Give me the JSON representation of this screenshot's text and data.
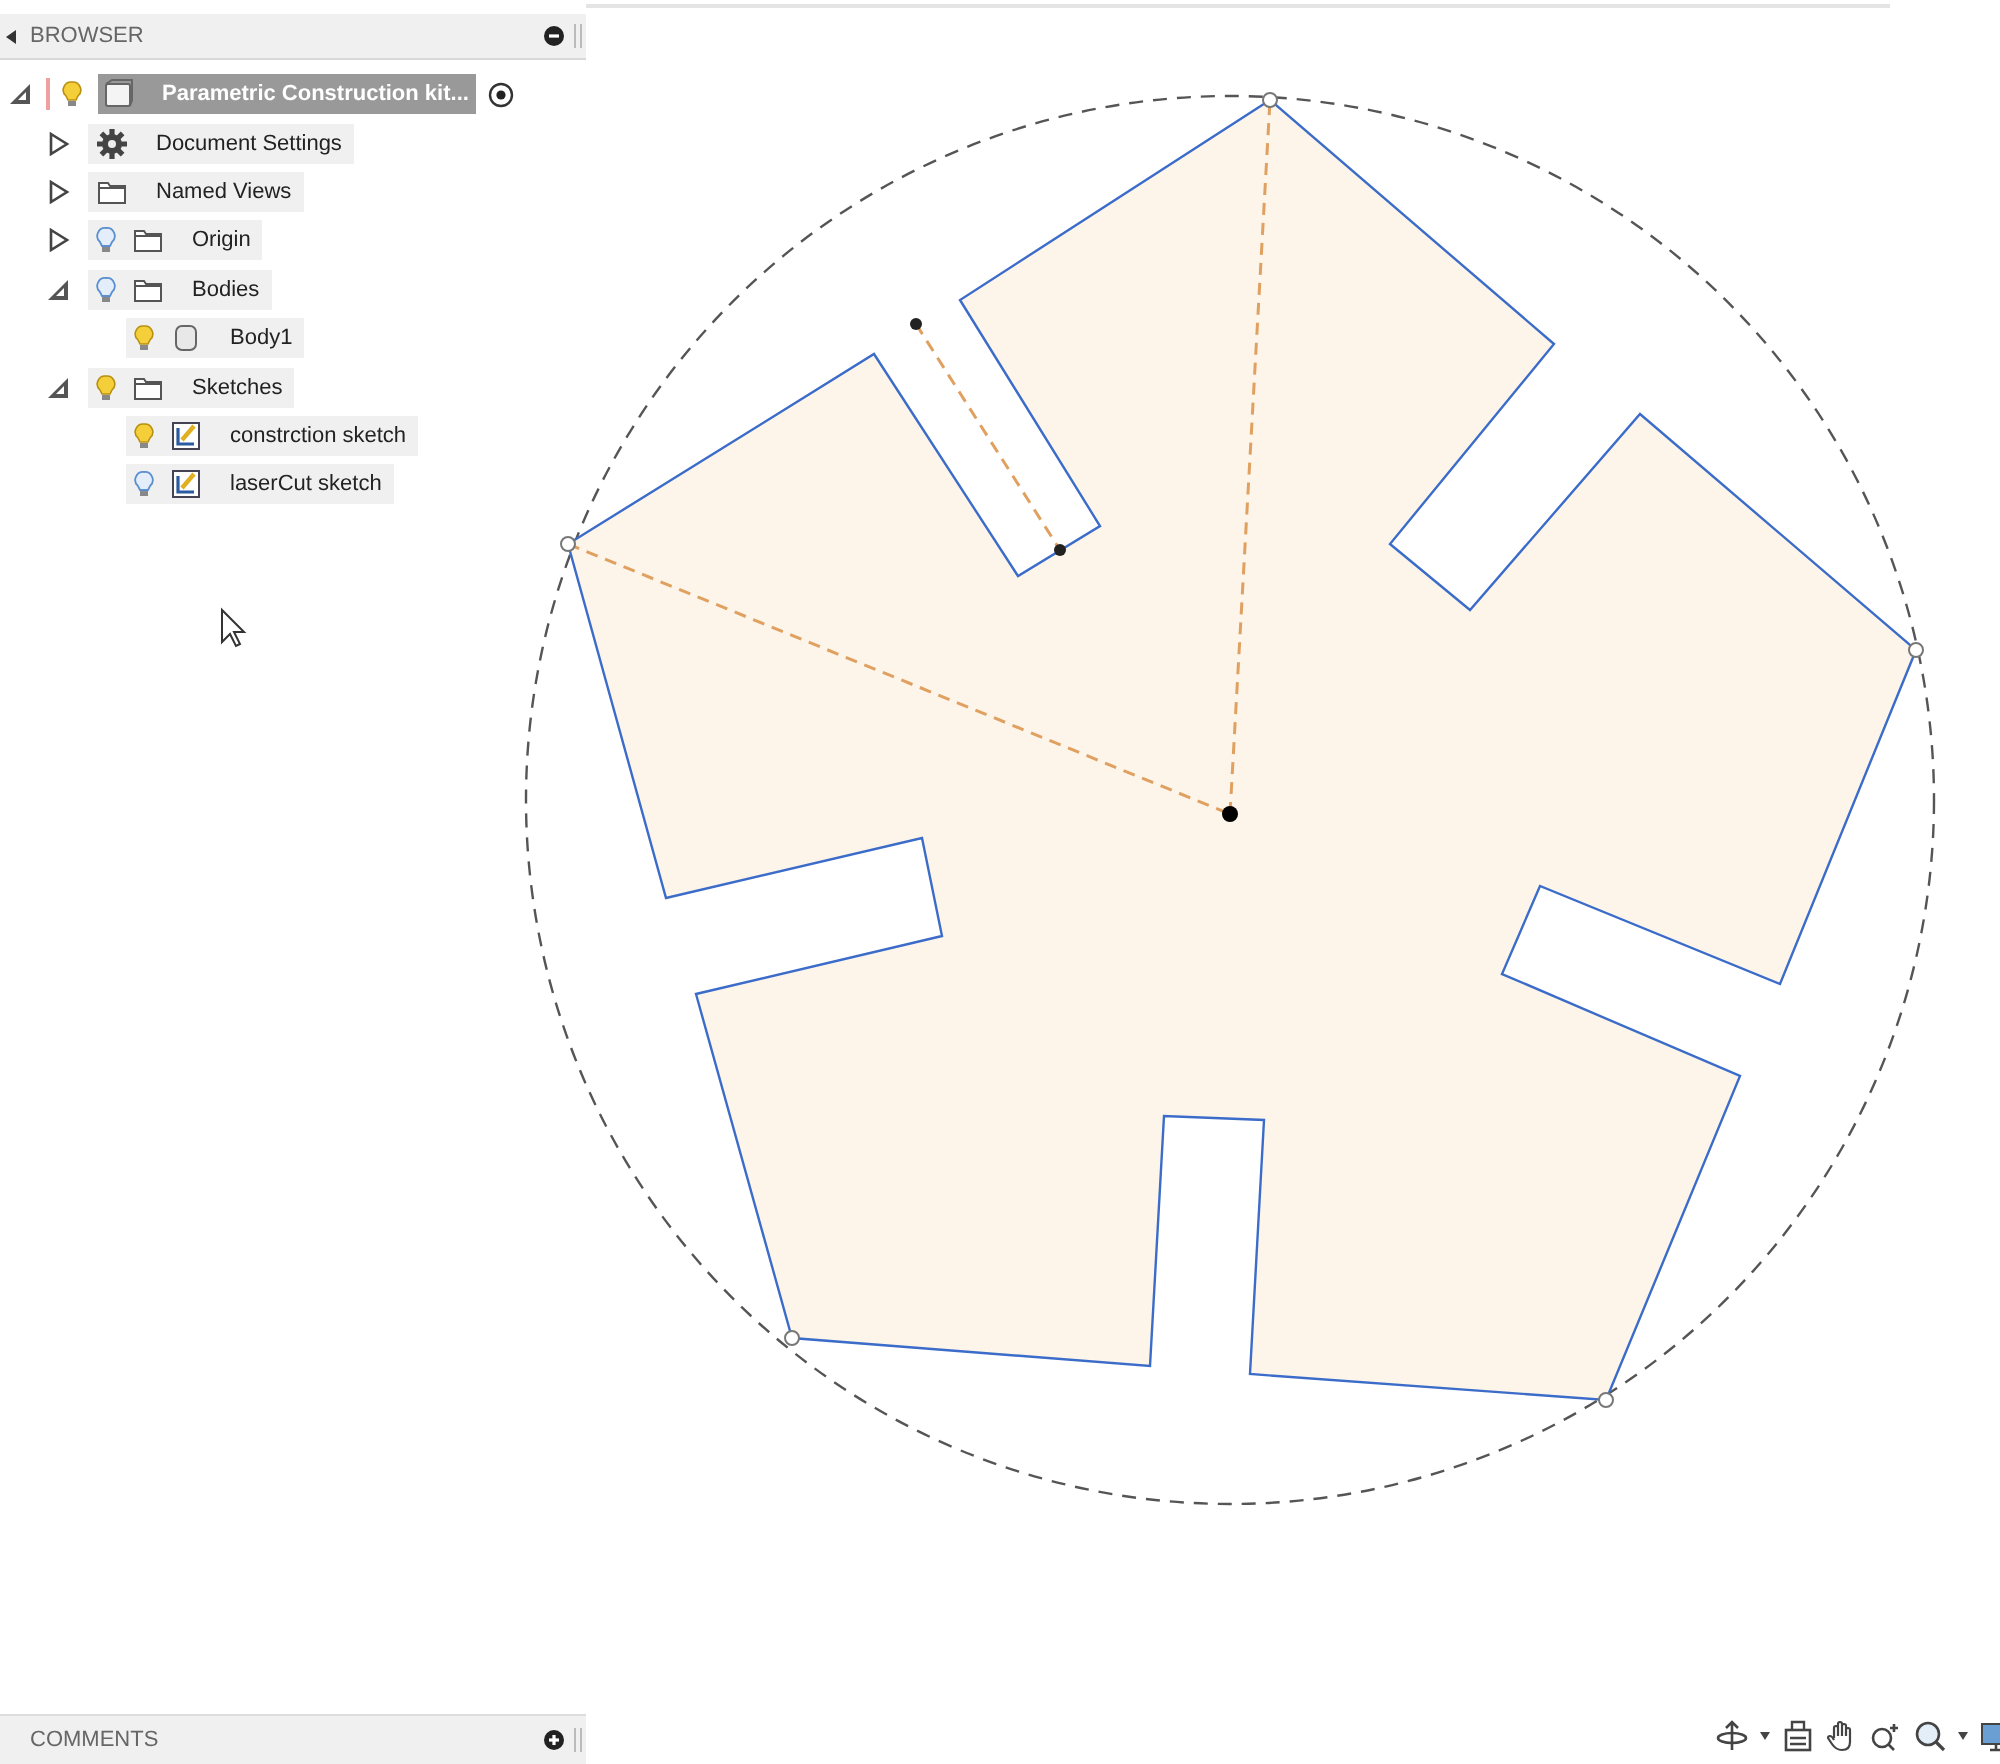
{
  "browser": {
    "title": "BROWSER",
    "tree": [
      {
        "label": "Parametric Construction kit...",
        "kind": "component",
        "expanded": true,
        "visible": true,
        "selected": true,
        "active": true,
        "children": [
          {
            "label": "Document Settings",
            "kind": "settings",
            "expanded": false,
            "selected": false
          },
          {
            "label": "Named Views",
            "kind": "folder",
            "expanded": false,
            "selected": false
          },
          {
            "label": "Origin",
            "kind": "folder",
            "expanded": false,
            "visible": false,
            "selected": false
          },
          {
            "label": "Bodies",
            "kind": "folder",
            "expanded": true,
            "visible": false,
            "selected": false,
            "children": [
              {
                "label": "Body1",
                "kind": "body",
                "visible": true,
                "selected": false
              }
            ]
          },
          {
            "label": "Sketches",
            "kind": "folder",
            "expanded": true,
            "visible": true,
            "selected": false,
            "children": [
              {
                "label": "constrction sketch",
                "kind": "sketch",
                "visible": true,
                "selected": false
              },
              {
                "label": "laserCut sketch",
                "kind": "sketch",
                "visible": false,
                "selected": false
              }
            ]
          }
        ]
      }
    ]
  },
  "comments": {
    "title": "COMMENTS"
  }
}
